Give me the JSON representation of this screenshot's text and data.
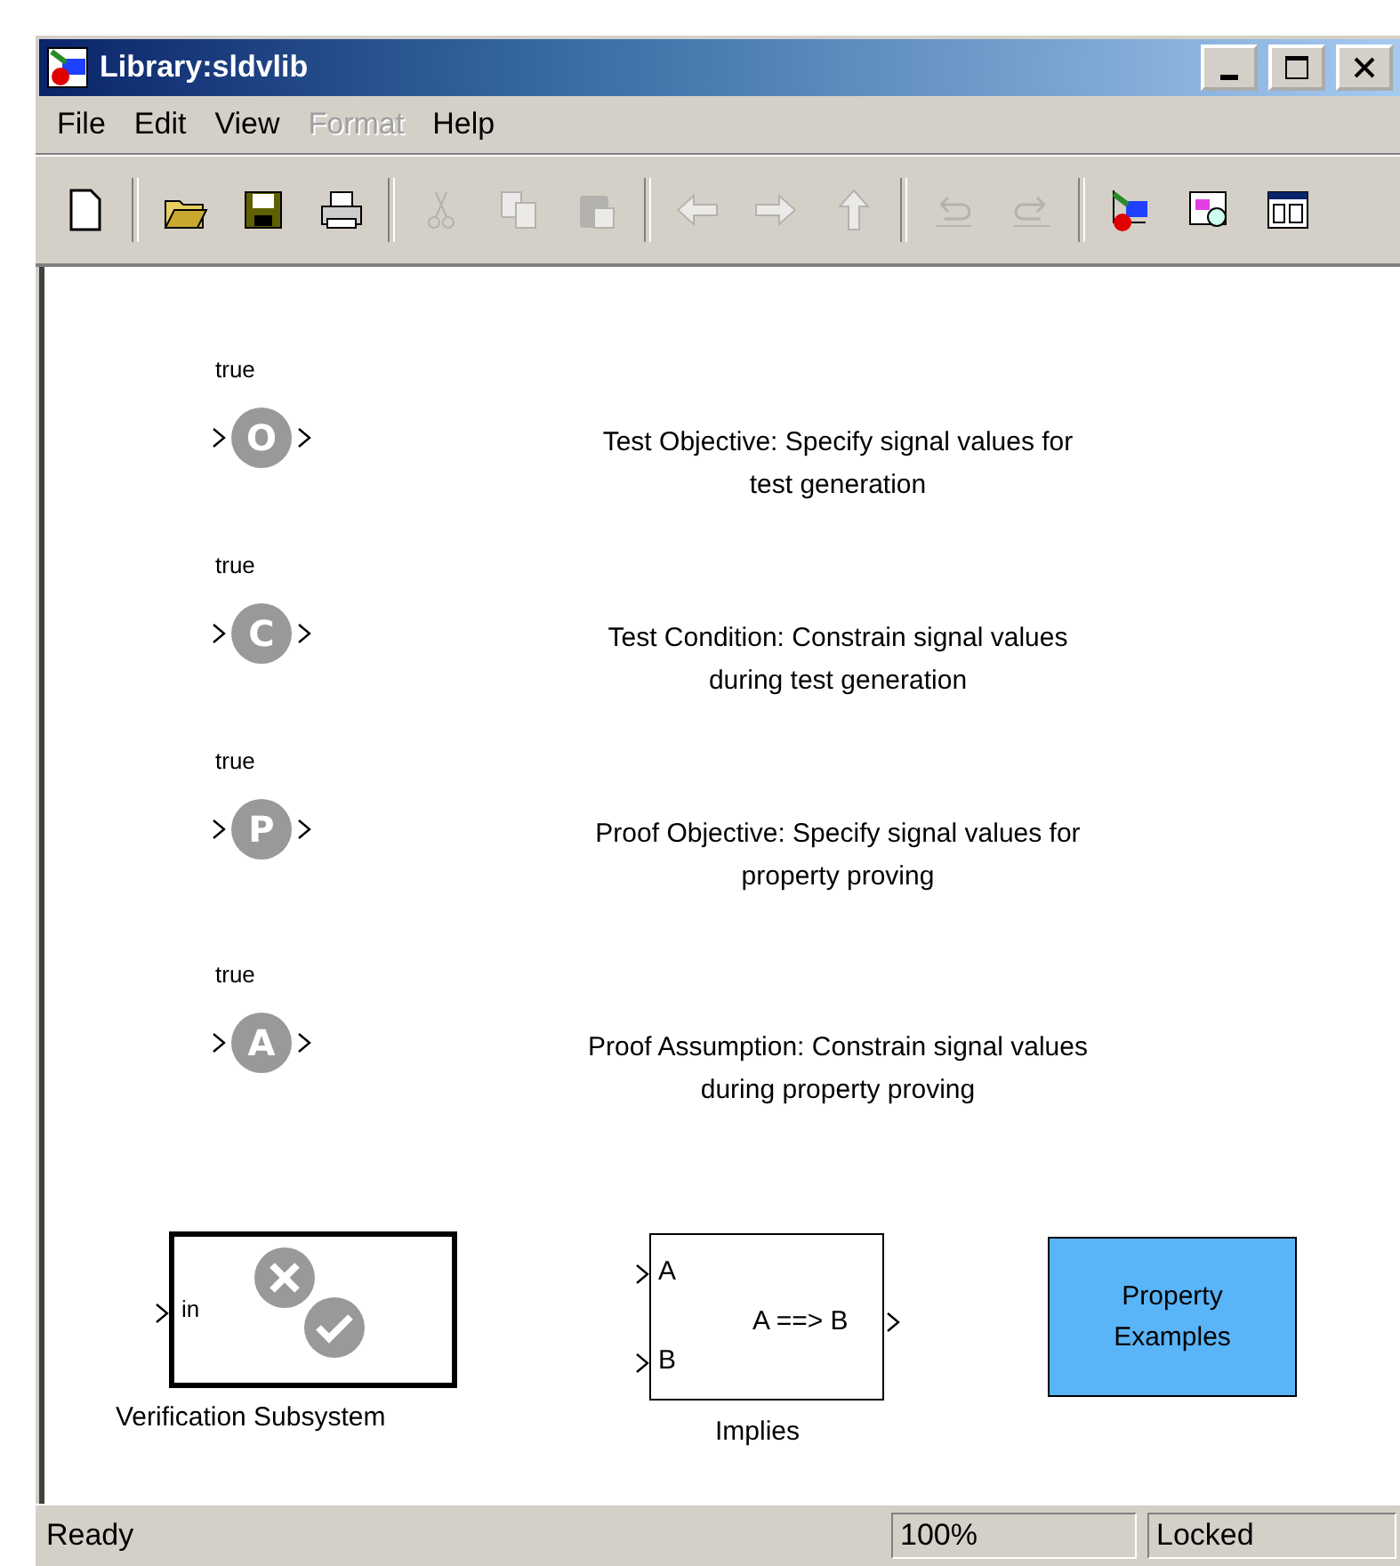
{
  "window": {
    "title": "Library:sldvlib"
  },
  "menu": [
    {
      "label": "File",
      "disabled": false
    },
    {
      "label": "Edit",
      "disabled": false
    },
    {
      "label": "View",
      "disabled": false
    },
    {
      "label": "Format",
      "disabled": true
    },
    {
      "label": "Help",
      "disabled": false
    }
  ],
  "toolbar": [
    {
      "kind": "new",
      "disabled": false
    },
    {
      "kind": "separator"
    },
    {
      "kind": "open",
      "disabled": false
    },
    {
      "kind": "save",
      "disabled": false
    },
    {
      "kind": "print",
      "disabled": false
    },
    {
      "kind": "separator"
    },
    {
      "kind": "cut",
      "disabled": true
    },
    {
      "kind": "copy",
      "disabled": true
    },
    {
      "kind": "paste",
      "disabled": true
    },
    {
      "kind": "separator"
    },
    {
      "kind": "back",
      "disabled": true
    },
    {
      "kind": "forward",
      "disabled": true
    },
    {
      "kind": "up",
      "disabled": true
    },
    {
      "kind": "separator"
    },
    {
      "kind": "undo",
      "disabled": true
    },
    {
      "kind": "redo",
      "disabled": true
    },
    {
      "kind": "separator"
    },
    {
      "kind": "library",
      "disabled": false
    },
    {
      "kind": "browser",
      "disabled": false
    },
    {
      "kind": "properties",
      "disabled": false
    }
  ],
  "objective_blocks": [
    {
      "label": "true",
      "letter": "O",
      "description": [
        "Test Objective: Specify signal values for",
        "test generation"
      ]
    },
    {
      "label": "true",
      "letter": "C",
      "description": [
        "Test Condition: Constrain signal values",
        "during test generation"
      ]
    },
    {
      "label": "true",
      "letter": "P",
      "description": [
        "Proof Objective: Specify signal values for",
        "property proving"
      ]
    },
    {
      "label": "true",
      "letter": "A",
      "description": [
        "Proof Assumption: Constrain signal values",
        "during property proving"
      ]
    }
  ],
  "verification_subsystem": {
    "port": "in",
    "label": "Verification Subsystem"
  },
  "implies_block": {
    "inputs": [
      "A",
      "B"
    ],
    "expression": "A ==> B",
    "label": "Implies"
  },
  "property_examples": {
    "lines": [
      "Property",
      "Examples"
    ]
  },
  "status_bar": {
    "message": "Ready",
    "zoom": "100%",
    "mode": "Locked"
  }
}
